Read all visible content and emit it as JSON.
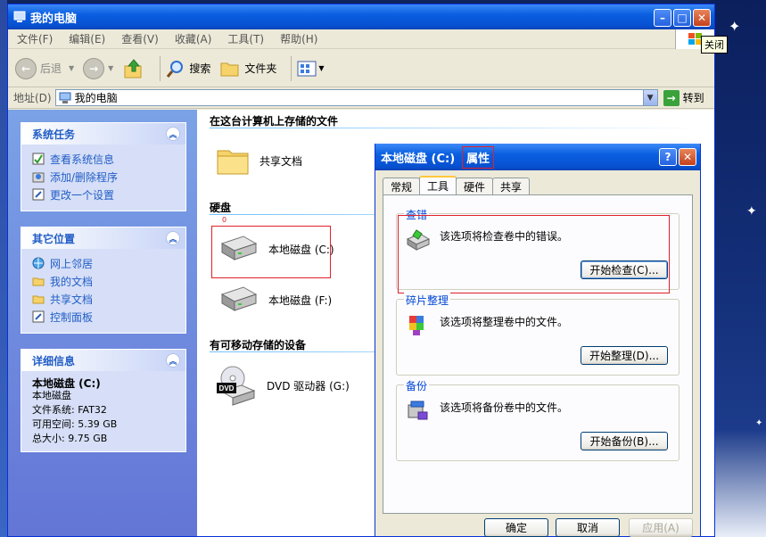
{
  "window": {
    "title": "我的电脑",
    "close_tooltip": "关闭"
  },
  "menu": [
    "文件(F)",
    "编辑(E)",
    "查看(V)",
    "收藏(A)",
    "工具(T)",
    "帮助(H)"
  ],
  "toolbar": {
    "back": "后退",
    "search": "搜索",
    "folders": "文件夹"
  },
  "address": {
    "label": "地址(D)",
    "value": "我的电脑",
    "go": "转到"
  },
  "left_pane": {
    "system_tasks": {
      "title": "系统任务",
      "items": [
        "查看系统信息",
        "添加/删除程序",
        "更改一个设置"
      ]
    },
    "other_places": {
      "title": "其它位置",
      "items": [
        "网上邻居",
        "我的文档",
        "共享文档",
        "控制面板"
      ]
    },
    "details": {
      "title": "详细信息",
      "name": "本地磁盘 (C:)",
      "type": "本地磁盘",
      "fs": "文件系统: FAT32",
      "free": "可用空间: 5.39 GB",
      "total": "总大小: 9.75 GB"
    }
  },
  "content": {
    "stored_title": "在这台计算机上存储的文件",
    "shared_docs": "共享文档",
    "hdd_title": "硬盘",
    "drive_c": "本地磁盘 (C:)",
    "drive_f": "本地磁盘 (F:)",
    "removable_title": "有可移动存储的设备",
    "dvd": "DVD 驱动器 (G:)",
    "dvd_badge": "DVD",
    "annotation": "0"
  },
  "dialog": {
    "title_prefix": "本地磁盘 (C:)",
    "title_highlight": "属性",
    "help": "?",
    "tabs": [
      "常规",
      "工具",
      "硬件",
      "共享"
    ],
    "active_tab": "工具",
    "check": {
      "label": "查错",
      "text": "该选项将检查卷中的错误。",
      "button": "开始检查(C)..."
    },
    "defrag": {
      "label": "碎片整理",
      "text": "该选项将整理卷中的文件。",
      "button": "开始整理(D)..."
    },
    "backup": {
      "label": "备份",
      "text": "该选项将备份卷中的文件。",
      "button": "开始备份(B)..."
    },
    "ok": "确定",
    "cancel": "取消",
    "apply": "应用(A)"
  }
}
